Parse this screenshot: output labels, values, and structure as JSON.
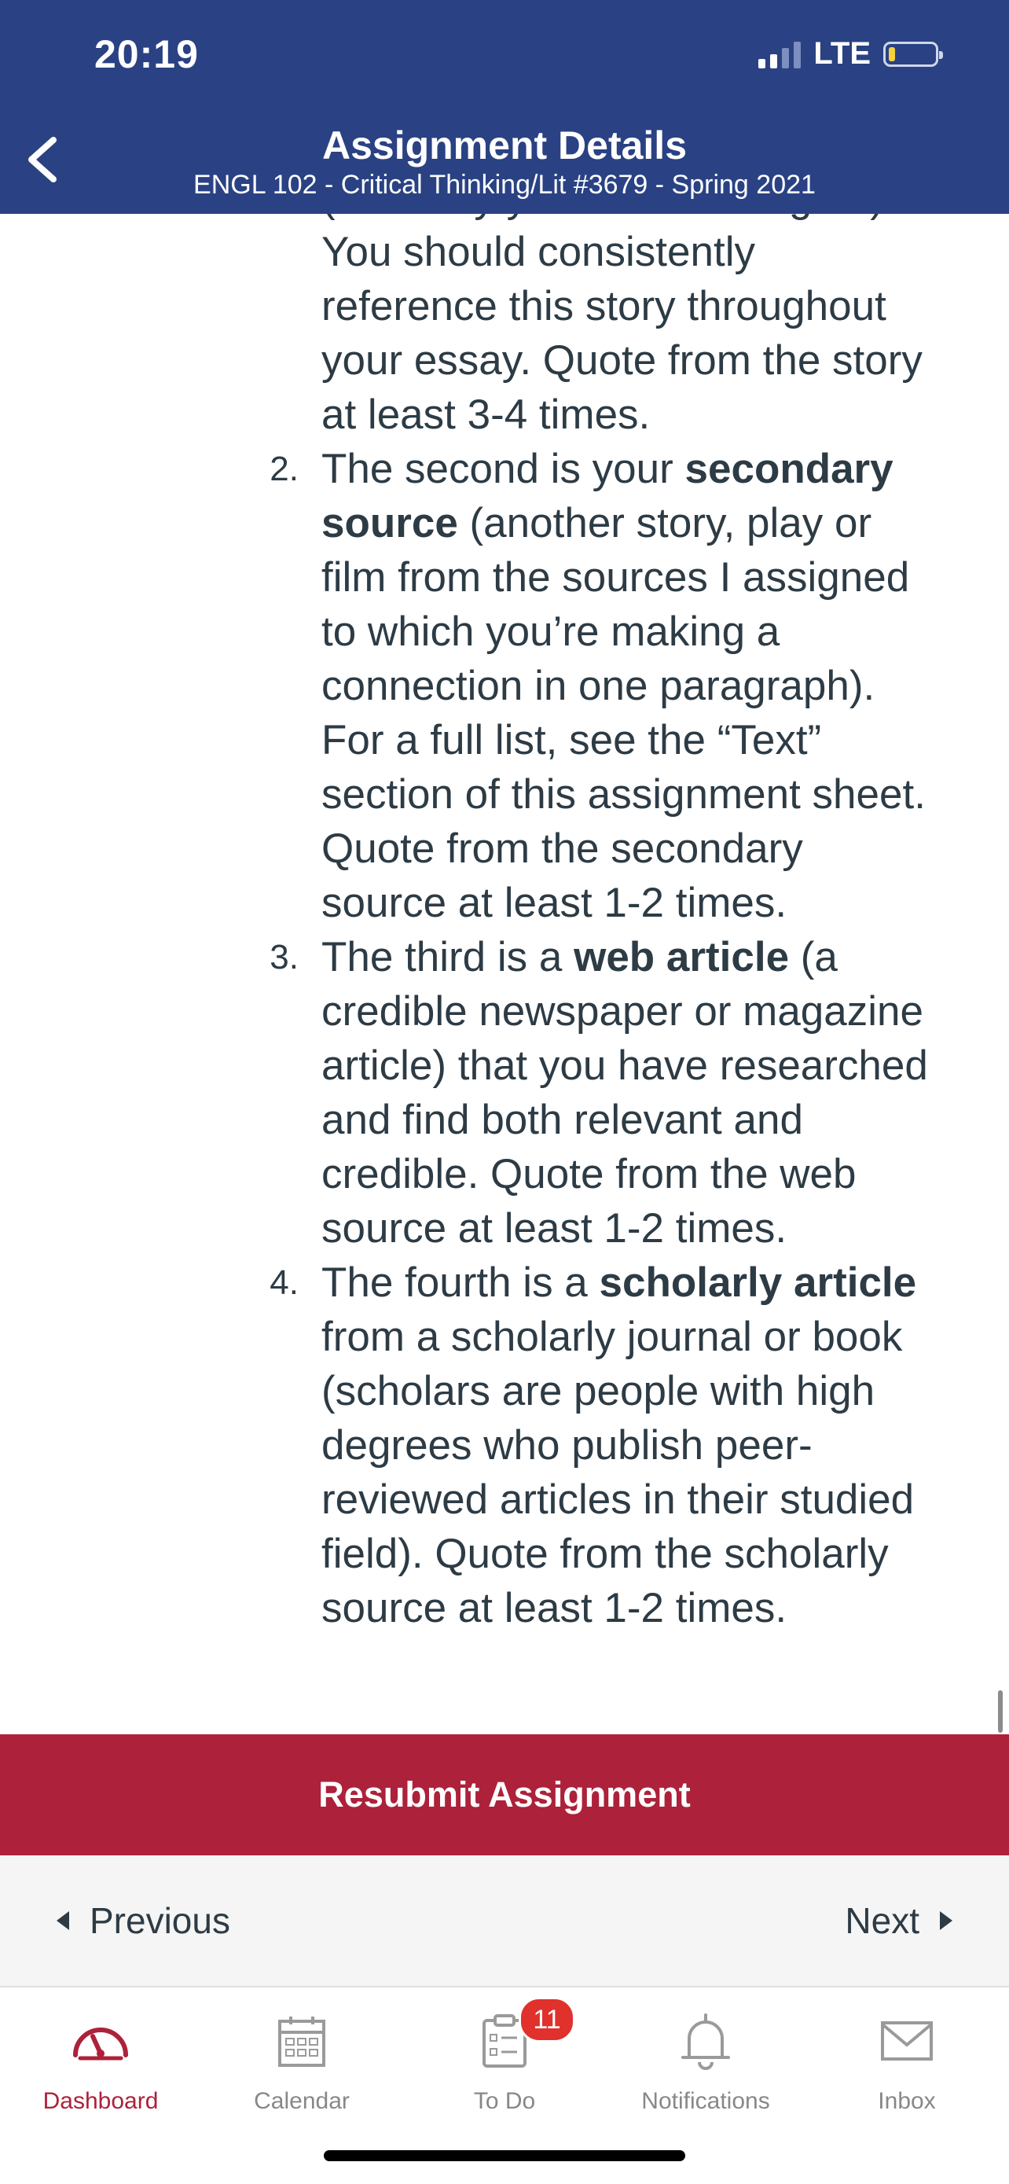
{
  "status_bar": {
    "time": "20:19",
    "network": "LTE"
  },
  "header": {
    "title": "Assignment Details",
    "subtitle": "ENGL 102 - Critical Thinking/Lit #3679 - Spring 2021",
    "background": "#2a4283"
  },
  "content": {
    "partial_top_line": "(the story you are focusing on).",
    "items": [
      {
        "number": "",
        "lines": [
          "You should consistently",
          "reference this story throughout",
          "your essay. Quote from the story",
          "at least 3-4 times."
        ]
      },
      {
        "number": "2.",
        "lines": [
          "The second is your ",
          "secondary",
          "source",
          " (another story, play or",
          "film from the sources I assigned",
          "to which you’re making a",
          "connection in one paragraph).",
          "For a full list, see the “Text”",
          "section of this assignment sheet.",
          "Quote from the secondary",
          "source at least 1-2 times."
        ]
      },
      {
        "number": "3.",
        "lines": [
          "The third is a ",
          "web article",
          " (a",
          "credible newspaper or magazine",
          "article) that you have researched",
          "and find both relevant and",
          "credible. Quote from the web",
          "source at least 1-2 times."
        ]
      },
      {
        "number": "4.",
        "lines": [
          "The fourth is a ",
          "scholarly article",
          "from a scholarly journal or book",
          "(scholars are people with high",
          "degrees who publish peer-",
          "reviewed articles in their studied",
          "field). Quote from the scholarly",
          "source at least 1-2 times."
        ]
      }
    ]
  },
  "actions": {
    "resubmit_label": "Resubmit Assignment",
    "resubmit_color": "#ad213a",
    "previous_label": "Previous",
    "next_label": "Next"
  },
  "tabbar": {
    "active_color": "#ad213a",
    "items": [
      {
        "label": "Dashboard",
        "icon": "dashboard-icon"
      },
      {
        "label": "Calendar",
        "icon": "calendar-icon"
      },
      {
        "label": "To Do",
        "icon": "todo-icon",
        "badge": "11"
      },
      {
        "label": "Notifications",
        "icon": "bell-icon"
      },
      {
        "label": "Inbox",
        "icon": "envelope-icon"
      }
    ]
  }
}
